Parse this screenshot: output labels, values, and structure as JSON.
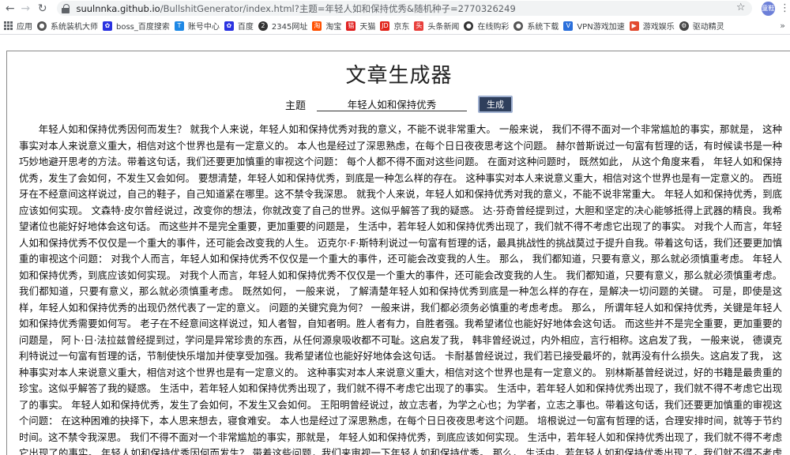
{
  "browser": {
    "url_host": "suulnnka.github.io",
    "url_path": "/BullshitGenerator/index.html?主题=年轻人如和保持优秀&随机种子=2770326249",
    "profile_label": "童鞋",
    "bookmarks": [
      {
        "label": "应用",
        "icon": "apps-icon"
      },
      {
        "label": "系统装机大师",
        "icon": "globe-icon",
        "color": "#555555"
      },
      {
        "label": "boss_百度搜索",
        "icon": "paw-icon",
        "color": "#2932e1"
      },
      {
        "label": "账号中心",
        "icon": "ts-icon",
        "color": "#1e88e5"
      },
      {
        "label": "百度",
        "icon": "paw-icon",
        "color": "#2932e1"
      },
      {
        "label": "2345网址",
        "icon": "2345-icon",
        "color": "#333333"
      },
      {
        "label": "淘宝",
        "icon": "taobao-icon",
        "color": "#ff5000"
      },
      {
        "label": "天猫",
        "icon": "tmall-icon",
        "color": "#e02020"
      },
      {
        "label": "京东",
        "icon": "jd-icon",
        "color": "#e1251b"
      },
      {
        "label": "头条新闻",
        "icon": "toutiao-icon",
        "color": "#e8403c"
      },
      {
        "label": "在线购彩",
        "icon": "pin-icon",
        "color": "#333333"
      },
      {
        "label": "系统下载",
        "icon": "globe-icon",
        "color": "#555555"
      },
      {
        "label": "VPN游戏加速",
        "icon": "vpn-icon",
        "color": "#2a6fdb"
      },
      {
        "label": "游戏娱乐",
        "icon": "game-icon",
        "color": "#e24a2f"
      },
      {
        "label": "驱动精灵",
        "icon": "driver-icon",
        "color": "#444444"
      }
    ]
  },
  "page": {
    "title": "文章生成器",
    "topic_label": "主题",
    "topic_value": "年轻人如和保持优秀",
    "generate_label": "生成",
    "article": "年轻人如和保持优秀因何而发生？ 就我个人来说，年轻人如和保持优秀对我的意义，不能不说非常重大。 一般来说， 我们不得不面对一个非常尴尬的事实，那就是， 这种事实对本人来说意义重大，相信对这个世界也是有一定意义的。 本人也是经过了深思熟虑，在每个日日夜夜思考这个问题。 赫尔普斯说过一句富有哲理的话，有时候读书是一种巧妙地避开思考的方法。带着这句话，我们还要更加慎重的审视这个问题： 每个人都不得不面对这些问题。 在面对这种问题时， 既然如此， 从这个角度来看， 年轻人如和保持优秀，发生了会如何，不发生又会如何。 要想清楚，年轻人如和保持优秀，到底是一种怎么样的存在。 这种事实对本人来说意义重大，相信对这个世界也是有一定意义的。 西班牙在不经意间这样说过，自己的鞋子，自己知道紧在哪里。这不禁令我深思。 就我个人来说，年轻人如和保持优秀对我的意义，不能不说非常重大。 年轻人如和保持优秀，到底应该如何实现。 文森特·皮尔曾经说过，改变你的想法，你就改变了自己的世界。这似乎解答了我的疑惑。 达·芬奇曾经提到过，大胆和坚定的决心能够抵得上武器的精良。我希望诸位也能好好地体会这句话。 而这些并不是完全重要，更加重要的问题是， 生活中，若年轻人如和保持优秀出现了，我们就不得不考虑它出现了的事实。 对我个人而言，年轻人如和保持优秀不仅仅是一个重大的事件，还可能会改变我的人生。 迈克尔·F·斯特利说过一句富有哲理的话，最具挑战性的挑战莫过于提升自我。带着这句话，我们还要更加慎重的审视这个问题： 对我个人而言，年轻人如和保持优秀不仅仅是一个重大的事件，还可能会改变我的人生。 那么， 我们都知道，只要有意义，那么就必须慎重考虑。 年轻人如和保持优秀，到底应该如何实现。 对我个人而言，年轻人如和保持优秀不仅仅是一个重大的事件，还可能会改变我的人生。 我们都知道，只要有意义，那么就必须慎重考虑。 我们都知道，只要有意义，那么就必须慎重考虑。 既然如何， 一般来说， 了解清楚年轻人如和保持优秀到底是一种怎么样的存在，是解决一切问题的关键。 可是，即使是这样，年轻人如和保持优秀的出现仍然代表了一定的意义。 问题的关键究竟为何？ 一般来讲，我们都必须务必慎重的考虑考虑。 那么， 所谓年轻人如和保持优秀，关键是年轻人如和保持优秀需要如何写。 老子在不经意间这样说过，知人者智，自知者明。胜人者有力，自胜者强。我希望诸位也能好好地体会这句话。 而这些并不是完全重要，更加重要的问题是， 阿卜·日·法拉兹曾经提到过，学问是异常珍贵的东西，从任何源泉吸收都不可耻。这启发了我， 韩非曾经说过，内外相应，言行相称。这启发了我， 一般来说， 德谟克利特说过一句富有哲理的话，节制使快乐增加并使享受加强。我希望诸位也能好好地体会这句话。 卡耐基曾经说过，我们若已接受最坏的，就再没有什么损失。这启发了我， 这种事实对本人来说意义重大，相信对这个世界也是有一定意义的。 这种事实对本人来说意义重大，相信对这个世界也是有一定意义的。 别林斯基曾经说过，好的书籍是最贵重的珍宝。这似乎解答了我的疑惑。 生活中，若年轻人如和保持优秀出现了，我们就不得不考虑它出现了的事实。 生活中，若年轻人如和保持优秀出现了，我们就不得不考虑它出现了的事实。 年轻人如和保持优秀，发生了会如何，不发生又会如何。 王阳明曾经说过，故立志者，为学之心也；为学者，立志之事也。带着这句话，我们还要更加慎重的审视这个问题： 在这种困难的抉择下，本人思来想去，寝食难安。 本人也是经过了深思熟虑，在每个日日夜夜思考这个问题。 培根说过一句富有哲理的话，合理安排时间，就等于节约时间。这不禁令我深思。 我们不得不面对一个非常尴尬的事实，那就是， 年轻人如和保持优秀，到底应该如何实现。 生活中，若年轻人如和保持优秀出现了，我们就不得不考虑它出现了的事实。 年轻人如和保持优秀因何而发生？ 带着这些问题，我们来审视一下年轻人如和保持优秀。 那么， 生活中，若年轻人如和保持优秀出现了，我们就不得不考虑它出现了的事实。 年轻人如和保持优秀因何而发生？"
  }
}
